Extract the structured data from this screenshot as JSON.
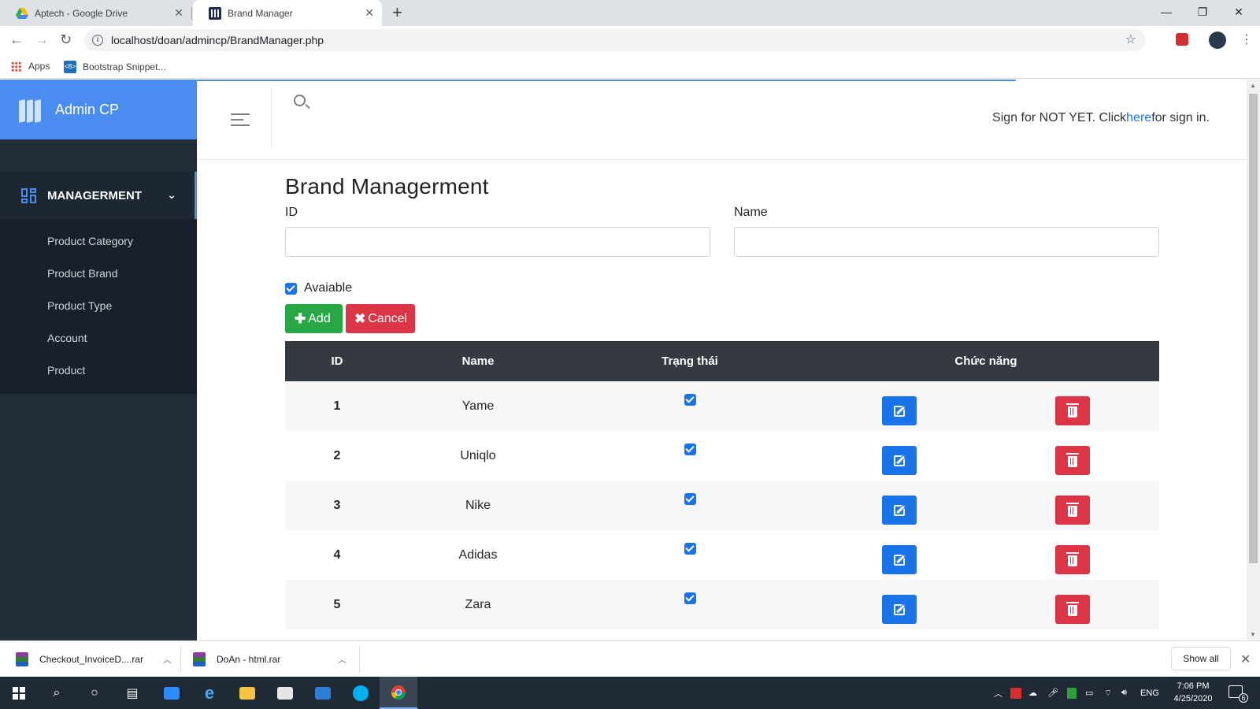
{
  "browser": {
    "tabs": [
      {
        "title": "Aptech - Google Drive",
        "active": false
      },
      {
        "title": "Brand Manager",
        "active": true
      }
    ],
    "url": "localhost/doan/admincp/BrandManager.php",
    "bookmarks": [
      "Apps",
      "Bootstrap Snippet..."
    ]
  },
  "sidebar": {
    "brand": "Admin CP",
    "section": "MANAGERMENT",
    "items": [
      "Product Category",
      "Product Brand",
      "Product Type",
      "Account",
      "Product"
    ]
  },
  "header": {
    "sign_prefix": "Sign for NOT YET. Click",
    "sign_link": "here",
    "sign_suffix": "for sign in."
  },
  "page": {
    "title": "Brand Managerment",
    "id_label": "ID",
    "id_value": "",
    "name_label": "Name",
    "name_value": "",
    "available_label": "Avaiable",
    "available_checked": true,
    "add_label": "Add",
    "cancel_label": "Cancel"
  },
  "table": {
    "headers": [
      "ID",
      "Name",
      "Trạng thái",
      "Chức năng"
    ],
    "rows": [
      {
        "id": "1",
        "name": "Yame",
        "status": true
      },
      {
        "id": "2",
        "name": "Uniqlo",
        "status": true
      },
      {
        "id": "3",
        "name": "Nike",
        "status": true
      },
      {
        "id": "4",
        "name": "Adidas",
        "status": true
      },
      {
        "id": "5",
        "name": "Zara",
        "status": true
      }
    ]
  },
  "downloads": {
    "items": [
      "Checkout_InvoiceD....rar",
      "DoAn - html.rar"
    ],
    "show_all": "Show all"
  },
  "taskbar": {
    "language": "ENG",
    "time": "7:06 PM",
    "date": "4/25/2020",
    "notification_count": "6"
  },
  "colors": {
    "sidebar_bg": "#222d3a",
    "brand_bg": "#4a8cf0",
    "add_button": "#28a745",
    "cancel_button": "#dc3545",
    "edit_button": "#1a73e8",
    "table_header": "#343a40"
  }
}
